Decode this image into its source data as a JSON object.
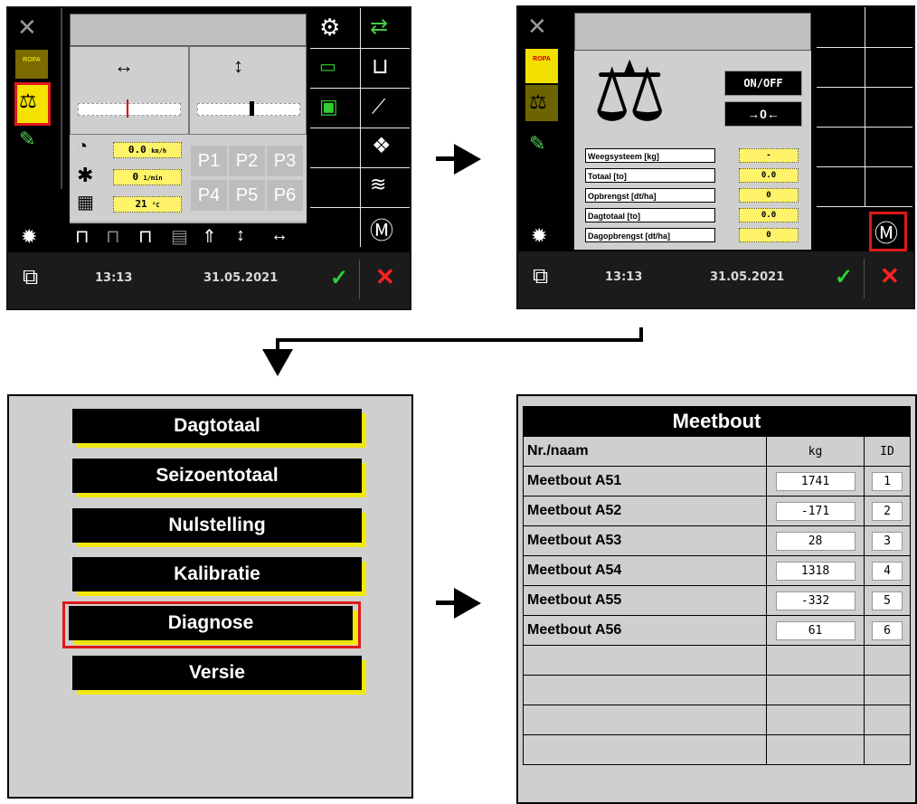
{
  "screen1": {
    "sidebar_label": "ROPA",
    "speed": "0.0",
    "speed_unit": "km/h",
    "rpm": "0",
    "rpm_unit": "1/min",
    "temp": "21",
    "temp_unit": "°C",
    "presets": [
      "P1",
      "P2",
      "P3",
      "P4",
      "P5",
      "P6"
    ],
    "time": "13:13",
    "date": "31.05.2021"
  },
  "screen2": {
    "sidebar_label": "ROPA",
    "onoff_label": "ON/OFF",
    "zero_label": "→0←",
    "rows": [
      {
        "label": "Weegsysteem [kg]",
        "value": "-"
      },
      {
        "label": "Totaal [to]",
        "value": "0.0"
      },
      {
        "label": "Opbrengst [dt/ha]",
        "value": "0"
      },
      {
        "label": "Dagtotaal [to]",
        "value": "0.0"
      },
      {
        "label": "Dagopbrengst [dt/ha]",
        "value": "0"
      }
    ],
    "time": "13:13",
    "date": "31.05.2021"
  },
  "menu": {
    "items": [
      "Dagtotaal",
      "Seizoentotaal",
      "Nulstelling",
      "Kalibratie",
      "Diagnose",
      "Versie"
    ],
    "highlighted": "Diagnose"
  },
  "meetbout": {
    "title": "Meetbout",
    "headers": [
      "Nr./naam",
      "kg",
      "ID"
    ],
    "rows": [
      {
        "name": "Meetbout A51",
        "kg": "1741",
        "id": "1"
      },
      {
        "name": "Meetbout A52",
        "kg": "-171",
        "id": "2"
      },
      {
        "name": "Meetbout A53",
        "kg": "28",
        "id": "3"
      },
      {
        "name": "Meetbout A54",
        "kg": "1318",
        "id": "4"
      },
      {
        "name": "Meetbout A55",
        "kg": "-332",
        "id": "5"
      },
      {
        "name": "Meetbout A56",
        "kg": "61",
        "id": "6"
      }
    ]
  },
  "colors": {
    "highlight_red": "#e01818",
    "yellow": "#fff36a",
    "panel_gray": "#cfcfcf"
  }
}
